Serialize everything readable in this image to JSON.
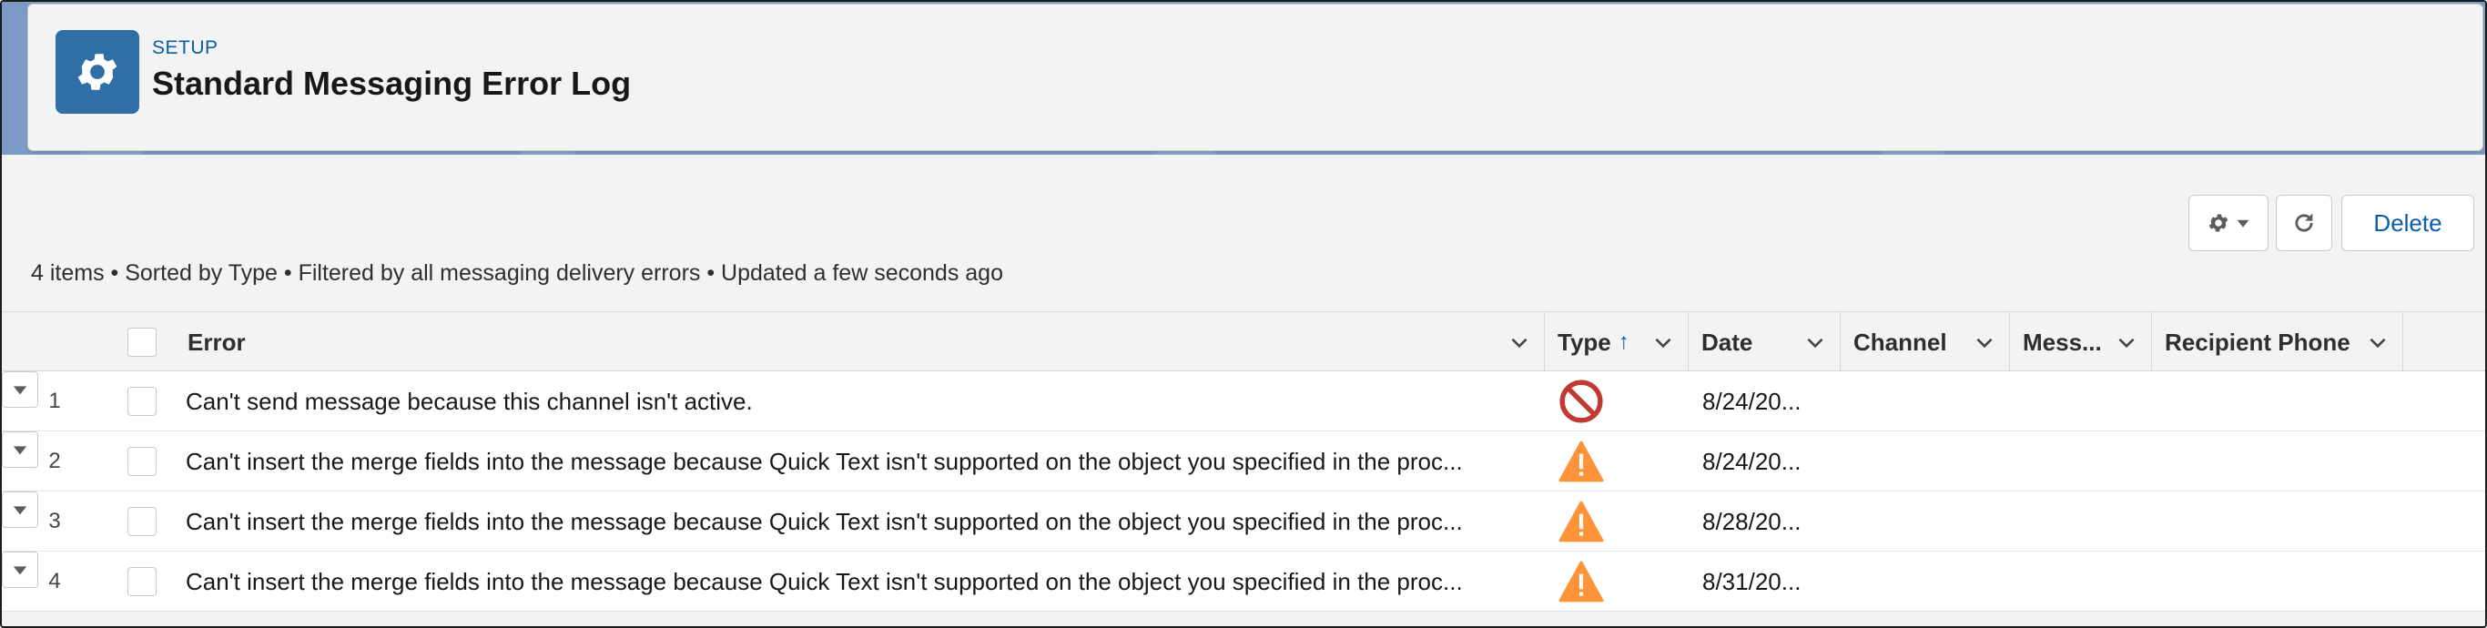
{
  "header": {
    "breadcrumb": "SETUP",
    "title": "Standard Messaging Error Log",
    "icon": "gear-icon"
  },
  "toolbar": {
    "settings_icon": "gear-icon",
    "refresh_icon": "refresh-icon",
    "delete_label": "Delete"
  },
  "list_info": "4 items • Sorted by Type • Filtered by all messaging delivery errors • Updated a few seconds ago",
  "columns": {
    "error": "Error",
    "type": "Type",
    "type_sort": "↑",
    "date": "Date",
    "channel": "Channel",
    "mess": "Mess...",
    "phone": "Recipient Phone"
  },
  "rows": [
    {
      "num": "1",
      "error": "Can't send message because this channel isn't active.",
      "type_icon": "error-icon",
      "date": "8/24/20...",
      "channel": "",
      "mess": "",
      "phone": ""
    },
    {
      "num": "2",
      "error": "Can't insert the merge fields into the message because Quick Text isn't supported on the object you specified in the proc...",
      "type_icon": "warning-icon",
      "date": "8/24/20...",
      "channel": "",
      "mess": "",
      "phone": ""
    },
    {
      "num": "3",
      "error": "Can't insert the merge fields into the message because Quick Text isn't supported on the object you specified in the proc...",
      "type_icon": "warning-icon",
      "date": "8/28/20...",
      "channel": "",
      "mess": "",
      "phone": ""
    },
    {
      "num": "4",
      "error": "Can't insert the merge fields into the message because Quick Text isn't supported on the object you specified in the proc...",
      "type_icon": "warning-icon",
      "date": "8/31/20...",
      "channel": "",
      "mess": "",
      "phone": ""
    }
  ],
  "colors": {
    "brand": "#2f6fa6",
    "link": "#0b5cab",
    "error": "#c23934",
    "warning": "#fe9339",
    "banner": "#7c9cc8"
  }
}
